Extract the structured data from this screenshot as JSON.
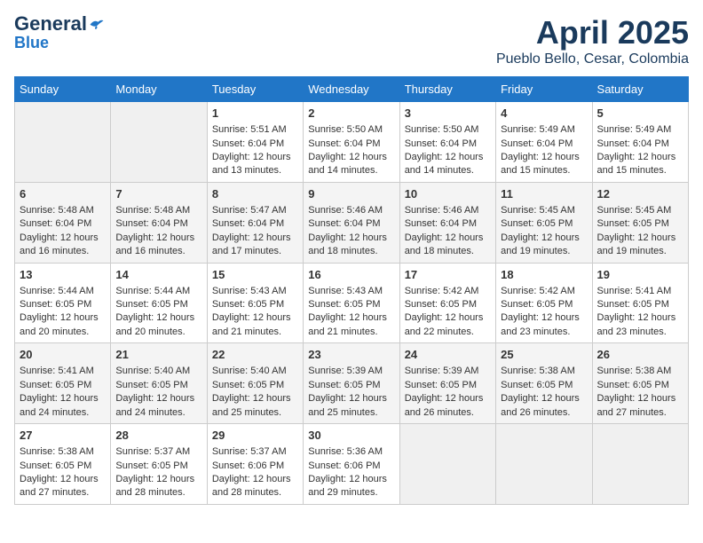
{
  "header": {
    "logo_line1": "General",
    "logo_line2": "Blue",
    "month": "April 2025",
    "location": "Pueblo Bello, Cesar, Colombia"
  },
  "days_of_week": [
    "Sunday",
    "Monday",
    "Tuesday",
    "Wednesday",
    "Thursday",
    "Friday",
    "Saturday"
  ],
  "weeks": [
    [
      {
        "day": "",
        "empty": true
      },
      {
        "day": "",
        "empty": true
      },
      {
        "day": "1",
        "sunrise": "Sunrise: 5:51 AM",
        "sunset": "Sunset: 6:04 PM",
        "daylight": "Daylight: 12 hours and 13 minutes."
      },
      {
        "day": "2",
        "sunrise": "Sunrise: 5:50 AM",
        "sunset": "Sunset: 6:04 PM",
        "daylight": "Daylight: 12 hours and 14 minutes."
      },
      {
        "day": "3",
        "sunrise": "Sunrise: 5:50 AM",
        "sunset": "Sunset: 6:04 PM",
        "daylight": "Daylight: 12 hours and 14 minutes."
      },
      {
        "day": "4",
        "sunrise": "Sunrise: 5:49 AM",
        "sunset": "Sunset: 6:04 PM",
        "daylight": "Daylight: 12 hours and 15 minutes."
      },
      {
        "day": "5",
        "sunrise": "Sunrise: 5:49 AM",
        "sunset": "Sunset: 6:04 PM",
        "daylight": "Daylight: 12 hours and 15 minutes."
      }
    ],
    [
      {
        "day": "6",
        "sunrise": "Sunrise: 5:48 AM",
        "sunset": "Sunset: 6:04 PM",
        "daylight": "Daylight: 12 hours and 16 minutes."
      },
      {
        "day": "7",
        "sunrise": "Sunrise: 5:48 AM",
        "sunset": "Sunset: 6:04 PM",
        "daylight": "Daylight: 12 hours and 16 minutes."
      },
      {
        "day": "8",
        "sunrise": "Sunrise: 5:47 AM",
        "sunset": "Sunset: 6:04 PM",
        "daylight": "Daylight: 12 hours and 17 minutes."
      },
      {
        "day": "9",
        "sunrise": "Sunrise: 5:46 AM",
        "sunset": "Sunset: 6:04 PM",
        "daylight": "Daylight: 12 hours and 18 minutes."
      },
      {
        "day": "10",
        "sunrise": "Sunrise: 5:46 AM",
        "sunset": "Sunset: 6:04 PM",
        "daylight": "Daylight: 12 hours and 18 minutes."
      },
      {
        "day": "11",
        "sunrise": "Sunrise: 5:45 AM",
        "sunset": "Sunset: 6:05 PM",
        "daylight": "Daylight: 12 hours and 19 minutes."
      },
      {
        "day": "12",
        "sunrise": "Sunrise: 5:45 AM",
        "sunset": "Sunset: 6:05 PM",
        "daylight": "Daylight: 12 hours and 19 minutes."
      }
    ],
    [
      {
        "day": "13",
        "sunrise": "Sunrise: 5:44 AM",
        "sunset": "Sunset: 6:05 PM",
        "daylight": "Daylight: 12 hours and 20 minutes."
      },
      {
        "day": "14",
        "sunrise": "Sunrise: 5:44 AM",
        "sunset": "Sunset: 6:05 PM",
        "daylight": "Daylight: 12 hours and 20 minutes."
      },
      {
        "day": "15",
        "sunrise": "Sunrise: 5:43 AM",
        "sunset": "Sunset: 6:05 PM",
        "daylight": "Daylight: 12 hours and 21 minutes."
      },
      {
        "day": "16",
        "sunrise": "Sunrise: 5:43 AM",
        "sunset": "Sunset: 6:05 PM",
        "daylight": "Daylight: 12 hours and 21 minutes."
      },
      {
        "day": "17",
        "sunrise": "Sunrise: 5:42 AM",
        "sunset": "Sunset: 6:05 PM",
        "daylight": "Daylight: 12 hours and 22 minutes."
      },
      {
        "day": "18",
        "sunrise": "Sunrise: 5:42 AM",
        "sunset": "Sunset: 6:05 PM",
        "daylight": "Daylight: 12 hours and 23 minutes."
      },
      {
        "day": "19",
        "sunrise": "Sunrise: 5:41 AM",
        "sunset": "Sunset: 6:05 PM",
        "daylight": "Daylight: 12 hours and 23 minutes."
      }
    ],
    [
      {
        "day": "20",
        "sunrise": "Sunrise: 5:41 AM",
        "sunset": "Sunset: 6:05 PM",
        "daylight": "Daylight: 12 hours and 24 minutes."
      },
      {
        "day": "21",
        "sunrise": "Sunrise: 5:40 AM",
        "sunset": "Sunset: 6:05 PM",
        "daylight": "Daylight: 12 hours and 24 minutes."
      },
      {
        "day": "22",
        "sunrise": "Sunrise: 5:40 AM",
        "sunset": "Sunset: 6:05 PM",
        "daylight": "Daylight: 12 hours and 25 minutes."
      },
      {
        "day": "23",
        "sunrise": "Sunrise: 5:39 AM",
        "sunset": "Sunset: 6:05 PM",
        "daylight": "Daylight: 12 hours and 25 minutes."
      },
      {
        "day": "24",
        "sunrise": "Sunrise: 5:39 AM",
        "sunset": "Sunset: 6:05 PM",
        "daylight": "Daylight: 12 hours and 26 minutes."
      },
      {
        "day": "25",
        "sunrise": "Sunrise: 5:38 AM",
        "sunset": "Sunset: 6:05 PM",
        "daylight": "Daylight: 12 hours and 26 minutes."
      },
      {
        "day": "26",
        "sunrise": "Sunrise: 5:38 AM",
        "sunset": "Sunset: 6:05 PM",
        "daylight": "Daylight: 12 hours and 27 minutes."
      }
    ],
    [
      {
        "day": "27",
        "sunrise": "Sunrise: 5:38 AM",
        "sunset": "Sunset: 6:05 PM",
        "daylight": "Daylight: 12 hours and 27 minutes."
      },
      {
        "day": "28",
        "sunrise": "Sunrise: 5:37 AM",
        "sunset": "Sunset: 6:05 PM",
        "daylight": "Daylight: 12 hours and 28 minutes."
      },
      {
        "day": "29",
        "sunrise": "Sunrise: 5:37 AM",
        "sunset": "Sunset: 6:06 PM",
        "daylight": "Daylight: 12 hours and 28 minutes."
      },
      {
        "day": "30",
        "sunrise": "Sunrise: 5:36 AM",
        "sunset": "Sunset: 6:06 PM",
        "daylight": "Daylight: 12 hours and 29 minutes."
      },
      {
        "day": "",
        "empty": true
      },
      {
        "day": "",
        "empty": true
      },
      {
        "day": "",
        "empty": true
      }
    ]
  ]
}
